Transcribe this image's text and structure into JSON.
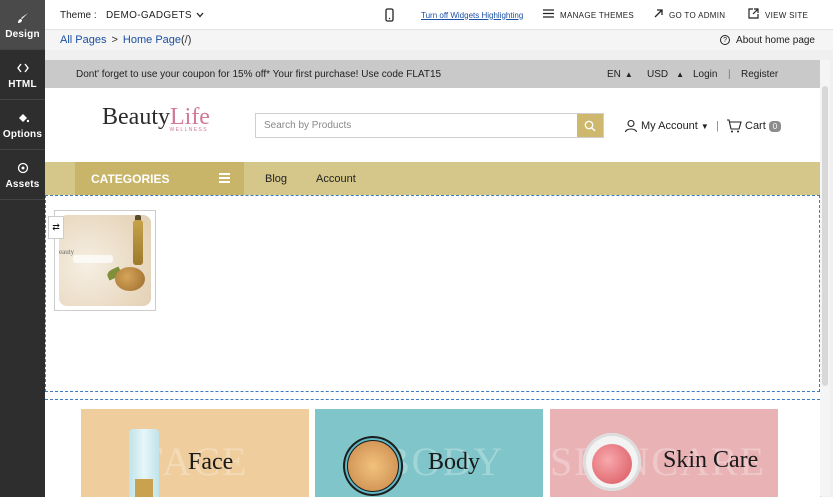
{
  "sidebar": {
    "items": [
      {
        "label": "Design",
        "icon": "brush-icon"
      },
      {
        "label": "HTML",
        "icon": "code-icon"
      },
      {
        "label": "Options",
        "icon": "paint-bucket-icon"
      },
      {
        "label": "Assets",
        "icon": "assets-icon"
      }
    ]
  },
  "topbar": {
    "theme_label": "Theme :",
    "theme_value": "DEMO-GADGETS",
    "widgets_link": "Turn off Widgets Highlighting",
    "manage_themes": "MANAGE THEMES",
    "go_to_admin": "GO TO ADMIN",
    "view_site": "VIEW SITE"
  },
  "breadcrumb": {
    "all_pages": "All Pages",
    "separator": ">",
    "home_page": "Home Page",
    "path": "(/)",
    "about": "About home page"
  },
  "site": {
    "promo_message": "Dont' forget to use your coupon for 15% off* Your first purchase! Use code FLAT15",
    "language": "EN",
    "currency": "USD",
    "login": "Login",
    "divider": "|",
    "register": "Register",
    "logo_main": "Beauty",
    "logo_accent": "Life",
    "logo_sub": "WELLNESS",
    "search_placeholder": "Search by Products",
    "account": "My Account",
    "cart": "Cart",
    "cart_count": "0",
    "categories": "CATEGORIES",
    "nav": [
      {
        "label": "Blog"
      },
      {
        "label": "Account"
      }
    ],
    "thumb_text": "eauty",
    "category_cards": [
      {
        "label": "Face",
        "ghost": "FACE"
      },
      {
        "label": "Body",
        "ghost": "BODY"
      },
      {
        "label": "Skin Care",
        "ghost": "SKINCARE"
      }
    ]
  },
  "colors": {
    "sidebar_bg": "#2e2e2e",
    "link_blue": "#1a4fa3",
    "promo_bg": "#c9c9c9",
    "gold": "#cdb86d",
    "nav_bg": "#d4c789",
    "category_bg": "#c8b56a",
    "logo_pink": "#d07a96",
    "face_bg": "#efcd9d",
    "body_bg": "#7fc5c9",
    "skin_bg": "#e9b3b6"
  }
}
